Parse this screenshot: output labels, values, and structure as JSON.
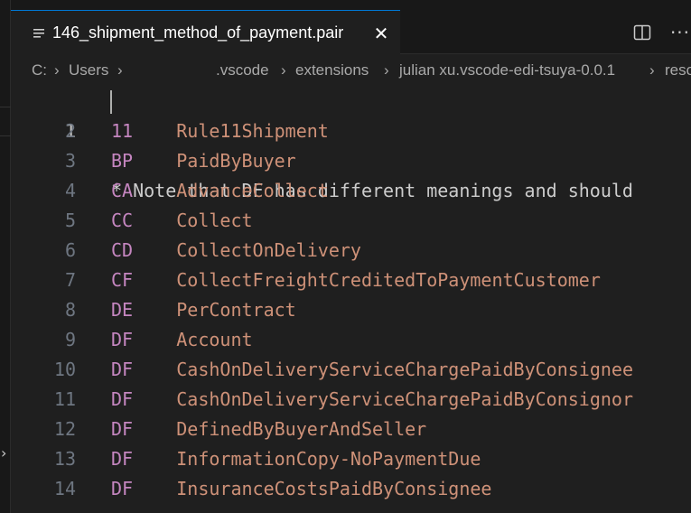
{
  "tab": {
    "label": "146_shipment_method_of_payment.pair",
    "icon": "lines-file-icon",
    "close_label": "✕"
  },
  "actions": {
    "split_icon": "split-editor-icon",
    "more_label": "···"
  },
  "breadcrumb": [
    "C:",
    "Users",
    ".vscode",
    "extensions",
    "julian xu.vscode-edi-tsuya-0.0.1",
    "reso"
  ],
  "editor": {
    "active_line": 1,
    "lines": [
      {
        "num": "1",
        "text": "* Note that DF has different meanings and should"
      },
      {
        "num": "2",
        "code": "11",
        "value": "Rule11Shipment"
      },
      {
        "num": "3",
        "code": "BP",
        "value": "PaidByBuyer"
      },
      {
        "num": "4",
        "code": "CA",
        "value": "AdvanceCollect"
      },
      {
        "num": "5",
        "code": "CC",
        "value": "Collect"
      },
      {
        "num": "6",
        "code": "CD",
        "value": "CollectOnDelivery"
      },
      {
        "num": "7",
        "code": "CF",
        "value": "CollectFreightCreditedToPaymentCustomer"
      },
      {
        "num": "8",
        "code": "DE",
        "value": "PerContract"
      },
      {
        "num": "9",
        "code": "DF",
        "value": "Account"
      },
      {
        "num": "10",
        "code": "DF",
        "value": "CashOnDeliveryServiceChargePaidByConsignee"
      },
      {
        "num": "11",
        "code": "DF",
        "value": "CashOnDeliveryServiceChargePaidByConsignor"
      },
      {
        "num": "12",
        "code": "DF",
        "value": "DefinedByBuyerAndSeller"
      },
      {
        "num": "13",
        "code": "DF",
        "value": "InformationCopy-NoPaymentDue"
      },
      {
        "num": "14",
        "code": "DF",
        "value": "InsuranceCostsPaidByConsignee"
      }
    ]
  },
  "colors": {
    "accent": "#0078d4",
    "code_keyword": "#c586c0",
    "code_value": "#ce9178"
  }
}
